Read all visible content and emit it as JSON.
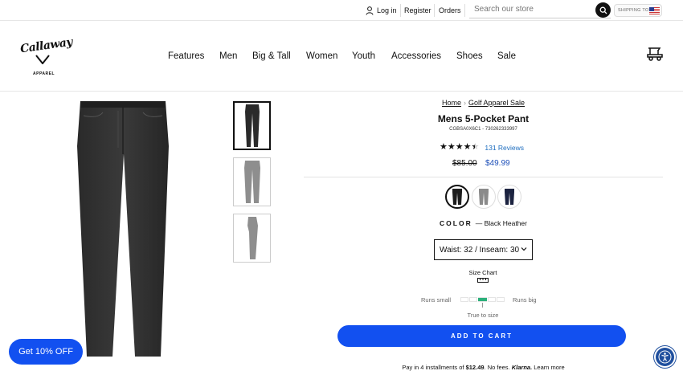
{
  "utility": {
    "login": "Log in",
    "register": "Register",
    "orders": "Orders",
    "search_placeholder": "Search our store",
    "shipping_label": "SHIPPING TO"
  },
  "header": {
    "brand": "Callaway",
    "brand_sub": "APPAREL",
    "nav": [
      "Features",
      "Men",
      "Big & Tall",
      "Women",
      "Youth",
      "Accessories",
      "Shoes",
      "Sale"
    ]
  },
  "breadcrumb": {
    "home": "Home",
    "category": "Golf Apparel Sale"
  },
  "product": {
    "title": "Mens 5-Pocket Pant",
    "sku": "CGBSA0X6C1 - 730262333997",
    "rating": 4.5,
    "reviews": "131 Reviews",
    "price_old": "$85.00",
    "price_new": "$49.99",
    "color_label": "COLOR",
    "color_value": "— Black Heather",
    "swatches": [
      {
        "color": "#1e1e1e"
      },
      {
        "color": "#8a8a8a"
      },
      {
        "color": "#1c2340"
      }
    ],
    "size_value": "Waist: 32 / Inseam: 30",
    "size_chart": "Size Chart",
    "fit": {
      "small": "Runs small",
      "big": "Runs big",
      "true": "True to size",
      "level": 0.5
    },
    "add_to_cart": "ADD TO CART",
    "klarna": {
      "prefix": "Pay in 4 installments of ",
      "amount": "$12.49",
      "mid": ". No fees. ",
      "brand": "Klarna.",
      "link": "Learn more"
    }
  },
  "promo": "Get 10% OFF",
  "colors": {
    "accent": "#1250f0",
    "price_sale": "#1d4fb8",
    "link": "#1d6dbf",
    "fit_marker": "#2bb07a"
  }
}
